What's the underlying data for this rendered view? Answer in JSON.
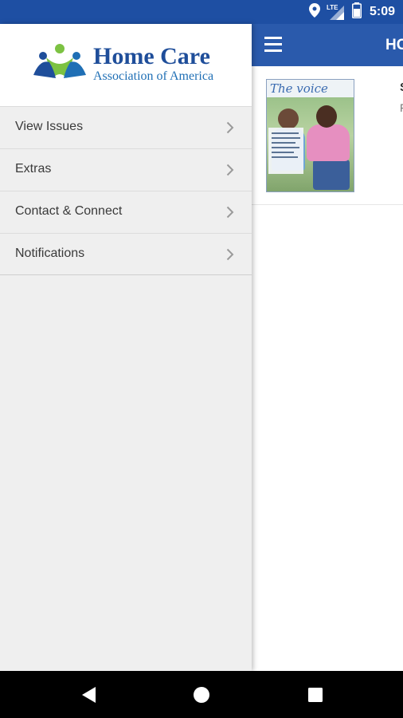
{
  "status_bar": {
    "network": "LTE",
    "time": "5:09"
  },
  "app_bar": {
    "title": "HC"
  },
  "issues": [
    {
      "cover_title": "The voice",
      "meta_line1": "S",
      "meta_line2": "F"
    }
  ],
  "drawer": {
    "logo": {
      "main": "Home Care",
      "sub": "Association of America"
    },
    "menu": [
      {
        "label": "View Issues"
      },
      {
        "label": "Extras"
      },
      {
        "label": "Contact & Connect"
      },
      {
        "label": "Notifications"
      }
    ]
  },
  "colors": {
    "status_bar": "#1e4fa3",
    "app_bar": "#2a5aac",
    "drawer_bg": "#efefef",
    "logo_blue": "#1f4e9a",
    "logo_green": "#7cc242"
  },
  "icons": {
    "status": [
      "location-icon",
      "signal-icon",
      "battery-icon"
    ],
    "nav": [
      "back-icon",
      "home-icon",
      "recents-icon"
    ],
    "menu_item": "chevron-right-icon",
    "app_bar": "hamburger-menu-icon"
  }
}
